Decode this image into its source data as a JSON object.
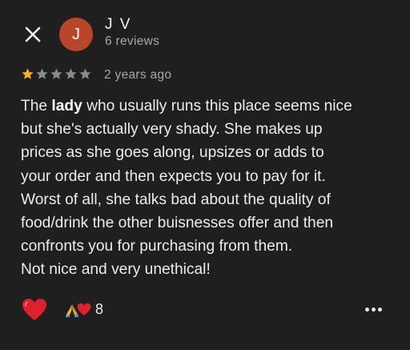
{
  "header": {
    "avatar_letter": "J",
    "reviewer_name": "J V",
    "review_count": "6 reviews"
  },
  "rating": {
    "stars": 1,
    "max": 5,
    "filled_color": "#f3b51b",
    "empty_color": "#8a8a8a"
  },
  "time_ago": "2 years ago",
  "review": {
    "text_before": "The ",
    "highlight": "lady",
    "text_after": " who usually runs this place seems nice\nbut she's actually very shady. She makes up\nprices as she goes along, upsizes or adds to\nyour order and then expects you to pay for it.\nWorst of all, she talks bad about the quality of\nfood/drink the other buisnesses offer and then\nconfronts you for purchasing from them.\nNot nice and very unethical!"
  },
  "reactions": {
    "primary": "heart",
    "group_icons": [
      "folded-hands",
      "heart"
    ],
    "count": "8"
  },
  "colors": {
    "background": "#1f1f1f",
    "avatar": "#b8462a",
    "heart": "#e0202a"
  }
}
